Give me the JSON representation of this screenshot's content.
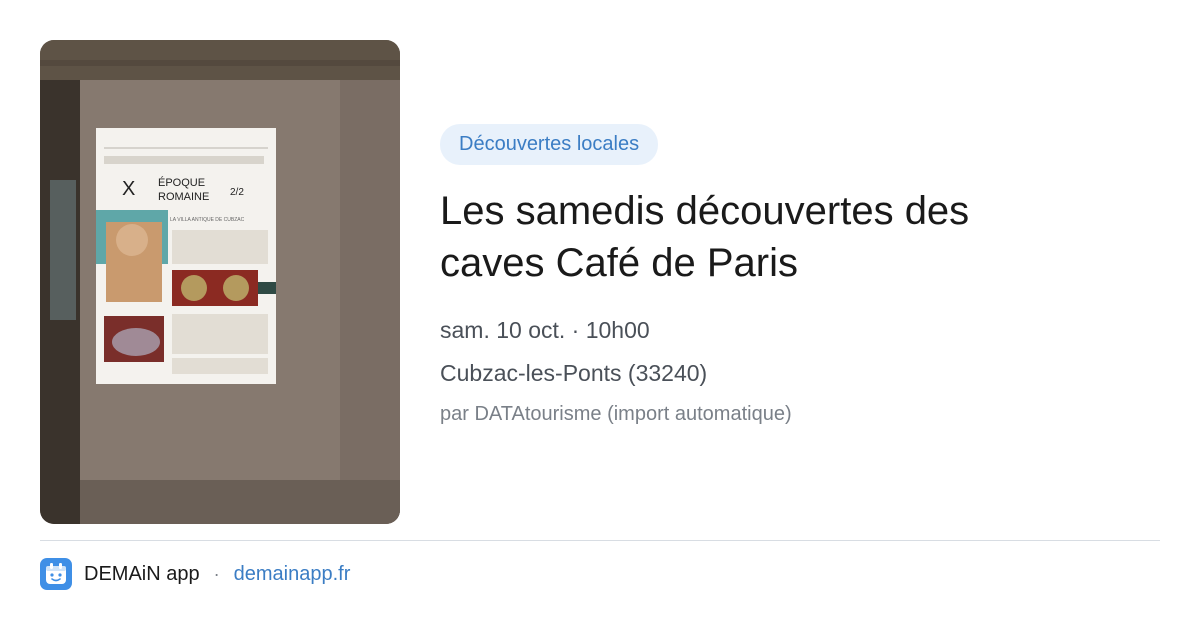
{
  "event": {
    "category": "Découvertes locales",
    "title": "Les samedis découvertes des caves Café de Paris",
    "datetime": "sam. 10 oct. · 10h00",
    "location": "Cubzac-les-Ponts (33240)",
    "source": "par DATAtourisme (import automatique)"
  },
  "image": {
    "poster": {
      "numeral": "X",
      "heading_line1": "ÉPOQUE",
      "heading_line2": "ROMAINE",
      "part": "2/2",
      "subtitle": "LA VILLA ANTIQUE DE CUBZAC"
    }
  },
  "footer": {
    "app_name": "DEMAiN app",
    "separator": "·",
    "url": "demainapp.fr"
  },
  "colors": {
    "accent": "#3b7dc4",
    "tag_background": "#e8f1fb",
    "logo_background": "#3f8fe6"
  },
  "icons": {
    "app_logo": "app-logo-icon"
  }
}
